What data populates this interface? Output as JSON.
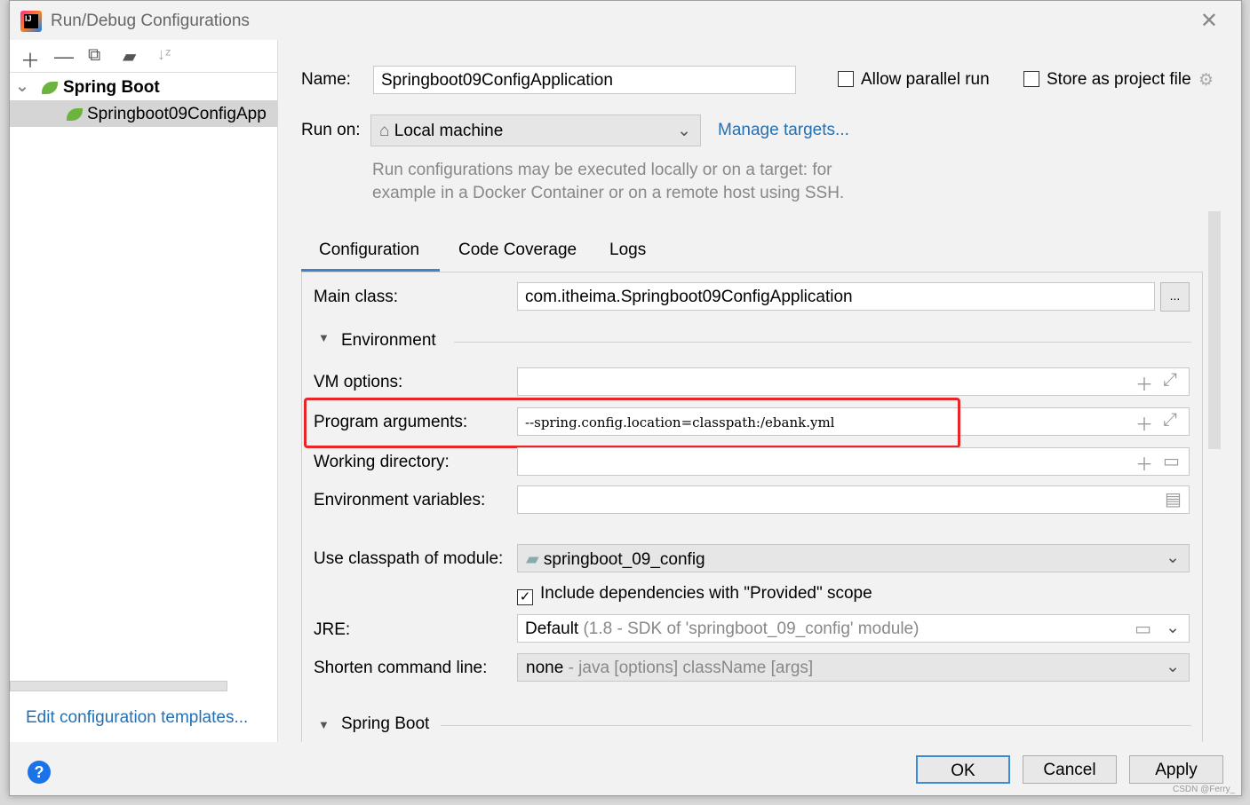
{
  "dialog": {
    "title": "Run/Debug Configurations"
  },
  "left": {
    "toolbar": [
      "add-icon",
      "remove-icon",
      "copy-icon",
      "new-folder-icon",
      "sort-icon"
    ],
    "tree": {
      "group": "Spring Boot",
      "item": "Springboot09ConfigApp"
    },
    "edit_templates": "Edit configuration templates..."
  },
  "form": {
    "name_label": "Name:",
    "name_value": "Springboot09ConfigApplication",
    "allow_parallel": "Allow parallel run",
    "allow_parallel_checked": false,
    "store_project": "Store as project file",
    "store_project_checked": false,
    "run_on_label": "Run on:",
    "run_on_value": "Local machine",
    "manage_targets": "Manage targets...",
    "run_hint_1": "Run configurations may be executed locally or on a target: for",
    "run_hint_2": "example in a Docker Container or on a remote host using SSH.",
    "tabs": [
      {
        "label": "Configuration",
        "active": true
      },
      {
        "label": "Code Coverage"
      },
      {
        "label": "Logs"
      }
    ],
    "main_class_label": "Main class:",
    "main_class_value": "com.itheima.Springboot09ConfigApplication",
    "browse": "...",
    "environment": "Environment",
    "vm_options_label": "VM options:",
    "vm_options_value": "",
    "program_args_label": "Program arguments:",
    "program_args_value": "--spring.config.location=classpath:/ebank.yml",
    "working_dir_label": "Working directory:",
    "working_dir_value": "",
    "env_vars_label": "Environment variables:",
    "env_vars_value": "",
    "classpath_label": "Use classpath of module:",
    "classpath_value": "springboot_09_config",
    "include_deps": "Include dependencies with \"Provided\" scope",
    "include_deps_checked": true,
    "jre_label": "JRE:",
    "jre_value": "Default",
    "jre_hint": "(1.8 - SDK of 'springboot_09_config' module)",
    "shorten_label": "Shorten command line:",
    "shorten_value": "none",
    "shorten_hint": "- java [options] className [args]",
    "spring_boot_section": "Spring Boot"
  },
  "footer": {
    "ok": "OK",
    "cancel": "Cancel",
    "apply": "Apply"
  },
  "watermark": "CSDN @Ferry_",
  "highlight_color": "#e8262a"
}
